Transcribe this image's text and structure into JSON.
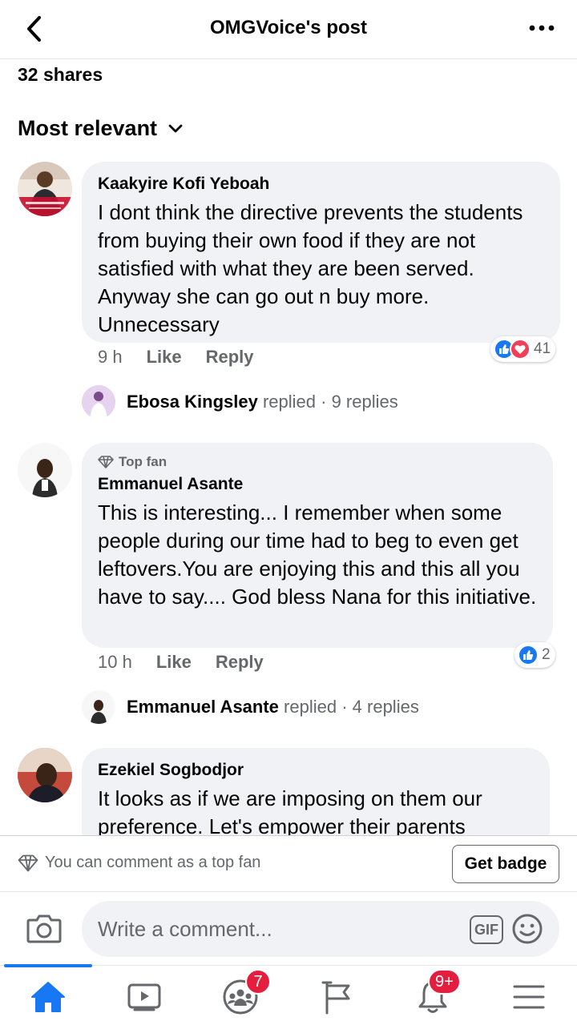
{
  "header": {
    "title": "OMGVoice's post"
  },
  "post": {
    "shares": "32 shares",
    "sort_label": "Most relevant"
  },
  "comments": [
    {
      "author": "Kaakyire Kofi Yeboah",
      "text": "I dont think the directive prevents the students from buying their own food if they are not satisfied with what they are been served.  Anyway she can go out n buy more. Unnecessary",
      "time": "9 h",
      "like_label": "Like",
      "reply_label": "Reply",
      "reaction_count": "41",
      "replies": {
        "name": "Ebosa Kingsley",
        "verb": "replied",
        "count": "· 9 replies"
      }
    },
    {
      "badge": "Top fan",
      "author": "Emmanuel Asante",
      "text": "This is interesting... I remember when some people during our time had to beg to even get leftovers.You are enjoying this and this all you have to say.... God bless Nana for this initiative.",
      "time": "10 h",
      "like_label": "Like",
      "reply_label": "Reply",
      "reaction_count": "2",
      "replies": {
        "name": "Emmanuel Asante",
        "verb": "replied",
        "count": "· 4 replies"
      }
    },
    {
      "author": "Ezekiel Sogbodjor",
      "text": "It looks as if we are imposing on them our preference. Let's empower their parents"
    }
  ],
  "topfan_bar": {
    "text": "You can comment as a top fan",
    "button": "Get badge"
  },
  "composer": {
    "placeholder": "Write a comment...",
    "gif_label": "GIF"
  },
  "tabbar": {
    "groups_badge": "7",
    "notifications_badge": "9+"
  },
  "colors": {
    "accent": "#1877f2",
    "bubble": "#f0f2f5",
    "muted": "#65676b",
    "badge": "#e41e3f"
  },
  "icons": [
    "back-arrow-icon",
    "more-icon",
    "chevron-down-icon",
    "like-icon",
    "love-icon",
    "diamond-icon",
    "camera-icon",
    "gif-icon",
    "emoji-icon",
    "home-icon",
    "watch-icon",
    "groups-icon",
    "pages-flag-icon",
    "bell-icon",
    "menu-icon"
  ]
}
